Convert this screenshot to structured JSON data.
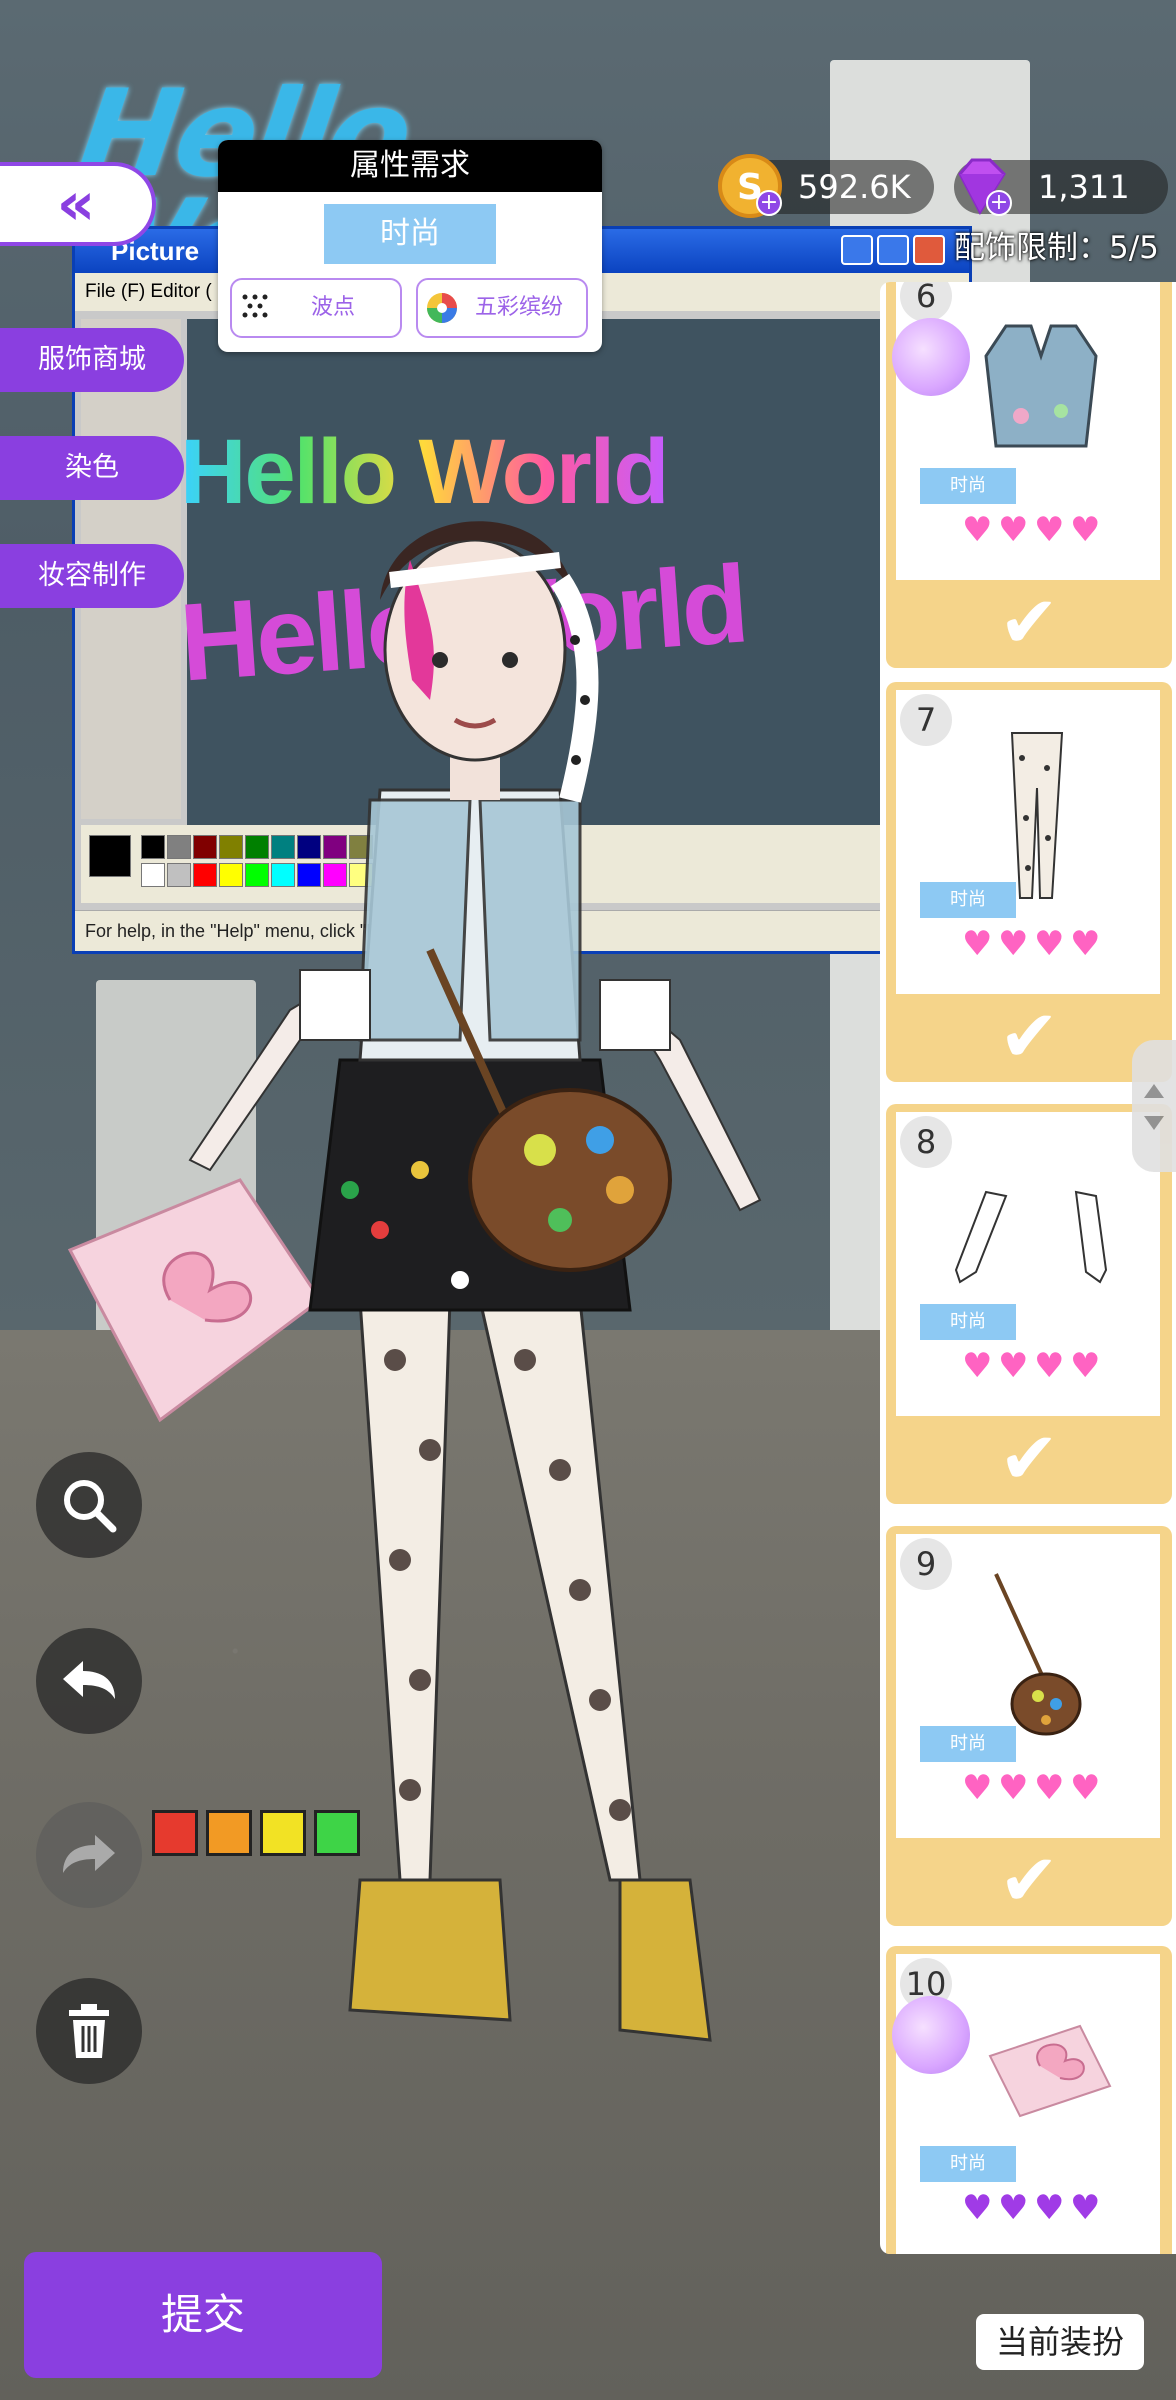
{
  "hud": {
    "attribute_panel": {
      "title": "属性需求",
      "main_attribute": "时尚",
      "tag_1": "波点",
      "tag_2": "五彩缤纷"
    },
    "currency": {
      "coins": "592.6K",
      "gems": "1,311"
    },
    "accessory_limit": "配饰限制：5/5",
    "side_tabs": [
      "服饰商城",
      "染色",
      "妆容制作"
    ],
    "submit_label": "提交",
    "current_outfit_label": "当前装扮"
  },
  "scene": {
    "neon_sign": "Hello World",
    "paint_window": {
      "title": "Picture",
      "menu": "File (F)   Editor (",
      "status": "For help, in the \"Help\" menu, click \"Help Topics\"."
    },
    "rainbow_text": "Hello World",
    "pink_text": "Hello World"
  },
  "items": [
    {
      "number": "6",
      "attribute": "时尚",
      "hearts": 4,
      "heart_color": "#ff63c2",
      "selected": true,
      "has_palette_badge": true,
      "icon": "vest-icon"
    },
    {
      "number": "7",
      "attribute": "时尚",
      "hearts": 4,
      "heart_color": "#ff63c2",
      "selected": true,
      "has_palette_badge": false,
      "icon": "polka-dot-tights-icon"
    },
    {
      "number": "8",
      "attribute": "时尚",
      "hearts": 4,
      "heart_color": "#ff63c2",
      "selected": true,
      "has_palette_badge": false,
      "icon": "lace-gloves-icon"
    },
    {
      "number": "9",
      "attribute": "时尚",
      "hearts": 4,
      "heart_color": "#ff63c2",
      "selected": true,
      "has_palette_badge": false,
      "icon": "palette-bag-icon"
    },
    {
      "number": "10",
      "attribute": "时尚",
      "hearts": 4,
      "heart_color": "#a03be6",
      "selected": false,
      "has_palette_badge": true,
      "icon": "gift-box-icon"
    }
  ],
  "colors": {
    "accent_purple": "#8a3fe0",
    "item_card_gold": "#f5d48a",
    "attribute_blue": "#8dc9f3"
  }
}
